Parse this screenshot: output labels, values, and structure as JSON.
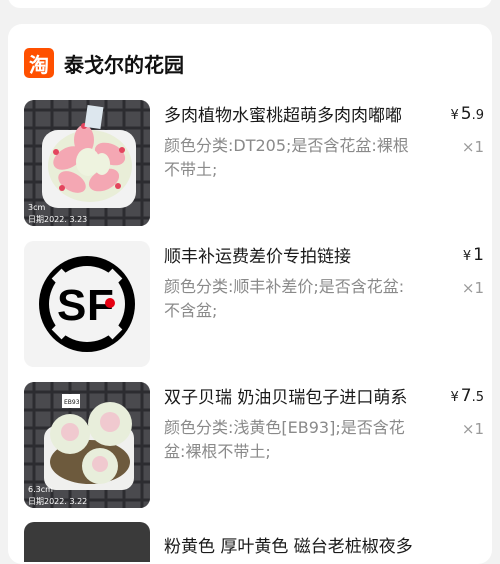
{
  "shop": {
    "logo_glyph": "淘",
    "name": "泰戈尔的花园",
    "accent": "#ff5000"
  },
  "items": [
    {
      "title": "多肉植物水蜜桃超萌多肉肉嘟嘟",
      "sku": "颜色分类:DT205;是否含花盆:裸根不带土;",
      "price_symbol": "¥",
      "price_int": "5",
      "price_dec": ".9",
      "qty": "×1",
      "image": "succulent-pink-photo"
    },
    {
      "title": "顺丰补运费差价专拍链接",
      "sku": "颜色分类:顺丰补差价;是否含花盆:不含盆;",
      "price_symbol": "¥",
      "price_int": "1",
      "price_dec": "",
      "qty": "×1",
      "image": "sf-express-logo"
    },
    {
      "title": "双子贝瑞 奶油贝瑞包子进口萌系",
      "sku": "颜色分类:浅黄色[EB93];是否含花盆:裸根不带土;",
      "price_symbol": "¥",
      "price_int": "7",
      "price_dec": ".5",
      "qty": "×1",
      "image": "succulent-cream-photo"
    }
  ],
  "photo_labels": {
    "item1_size": "3cm",
    "item1_date": "日期2022. 3.23",
    "item3_size": "6.3cm",
    "item3_date": "日期2022. 3.22",
    "item3_tag": "EB93"
  },
  "partial_item": {
    "title": "粉黄色 厚叶黄色 磁台老桩椒夜多"
  }
}
